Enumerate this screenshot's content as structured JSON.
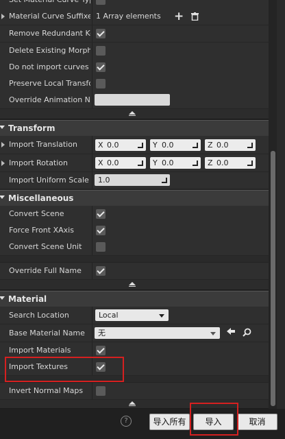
{
  "rows_top": {
    "cut_label": "Set Material Curve Type",
    "suffixes_label": "Material Curve Suffixes",
    "suffixes_value": "1 Array elements",
    "remove_redundant": "Remove Redundant Key",
    "delete_morph": "Delete Existing Morph T",
    "no_import_curves": "Do not import curves wit",
    "preserve_local": "Preserve Local Transfor",
    "override_anim": "Override Animation Nam"
  },
  "transform": {
    "title": "Transform",
    "translation_label": "Import Translation",
    "rotation_label": "Import Rotation",
    "uniform_label": "Import Uniform Scale",
    "x_axis": "X",
    "y_axis": "Y",
    "z_axis": "Z",
    "translation": [
      "0.0",
      "0.0",
      "0.0"
    ],
    "rotation": [
      "0.0",
      "0.0",
      "0.0"
    ],
    "uniform_value": "1.0"
  },
  "misc": {
    "title": "Miscellaneous",
    "convert_scene": "Convert Scene",
    "force_front": "Force Front XAxis",
    "convert_unit": "Convert Scene Unit",
    "override_full": "Override Full Name"
  },
  "material": {
    "title": "Material",
    "search_location_label": "Search Location",
    "search_location_value": "Local",
    "base_material_label": "Base Material Name",
    "base_material_value": "无",
    "import_materials": "Import Materials",
    "import_textures": "Import Textures",
    "invert_normal": "Invert Normal Maps"
  },
  "footer": {
    "help": "?",
    "import_all": "导入所有",
    "import": "导入",
    "cancel": "取消"
  },
  "colors": {
    "highlight": "#d62020",
    "panel": "#2f2f2f",
    "section": "#3b3b3b"
  }
}
